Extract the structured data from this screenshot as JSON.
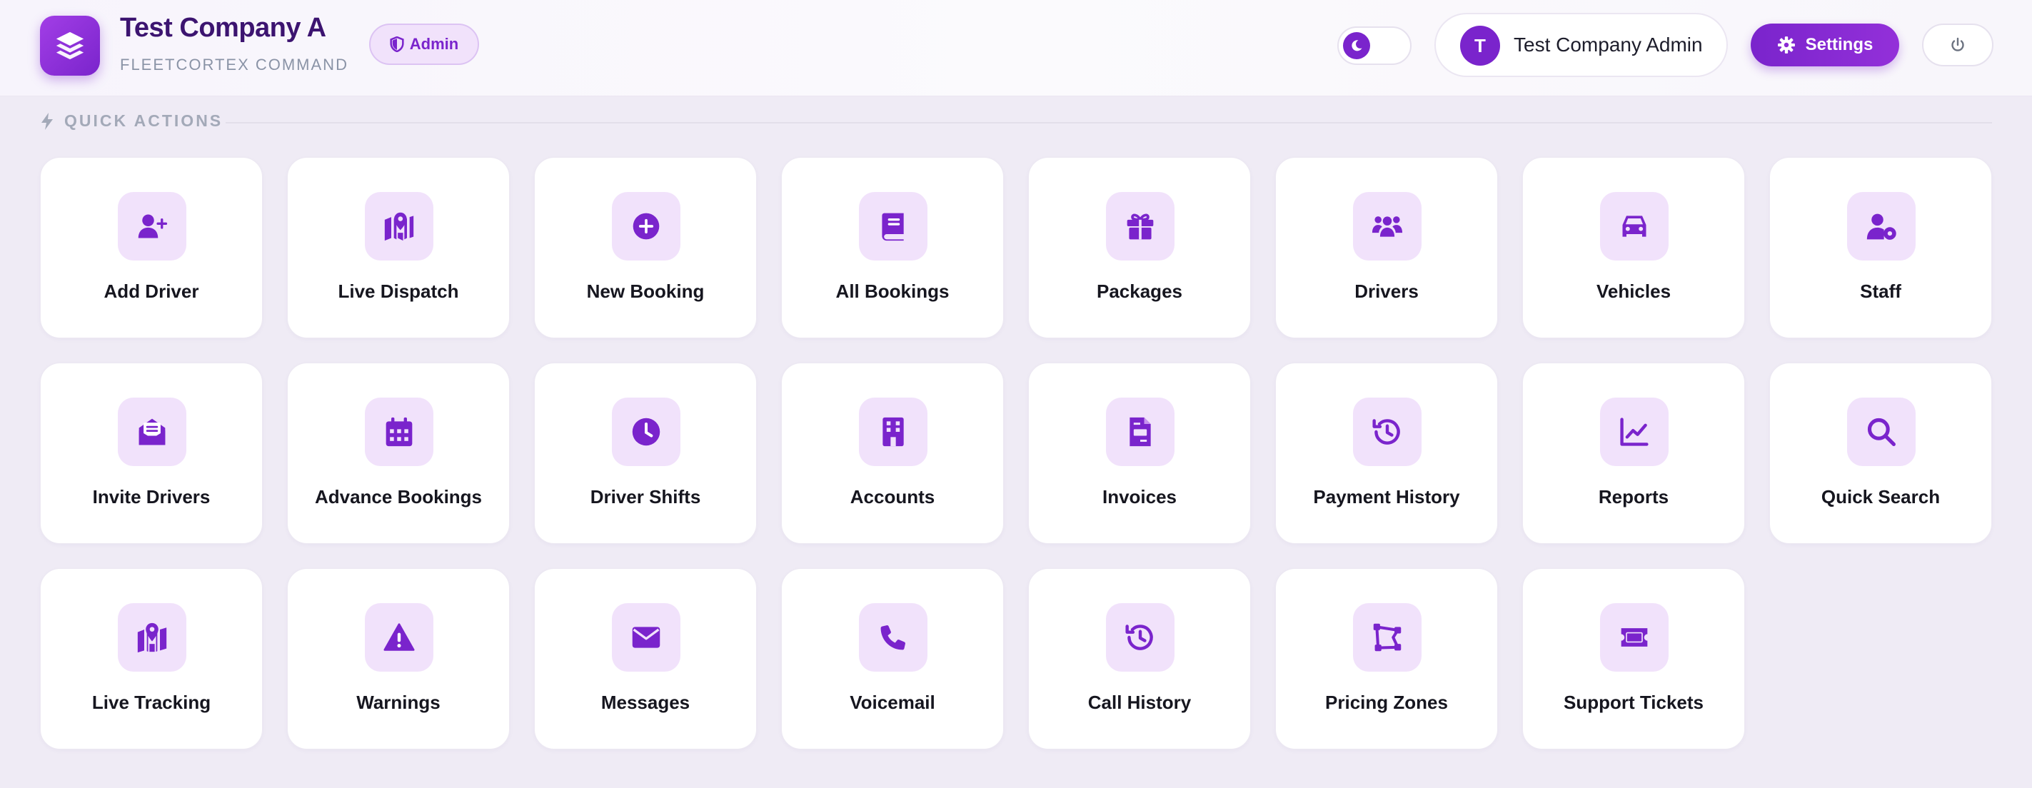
{
  "header": {
    "title": "Test Company A",
    "subtitle": "FLEETCORTEX COMMAND",
    "role_badge": "Admin",
    "user": {
      "avatar_initial": "T",
      "name": "Test Company Admin"
    },
    "settings_label": "Settings"
  },
  "theme": {
    "accent": "#7a24cc",
    "icon_bg": "#f1e2fb",
    "background": "#efebf5"
  },
  "quick_actions": {
    "title": "QUICK ACTIONS",
    "items": [
      {
        "label": "Add Driver",
        "icon": "user-plus-icon"
      },
      {
        "label": "Live Dispatch",
        "icon": "map-pin-icon"
      },
      {
        "label": "New Booking",
        "icon": "plus-circle-icon"
      },
      {
        "label": "All Bookings",
        "icon": "book-icon"
      },
      {
        "label": "Packages",
        "icon": "gift-icon"
      },
      {
        "label": "Drivers",
        "icon": "users-icon"
      },
      {
        "label": "Vehicles",
        "icon": "car-icon"
      },
      {
        "label": "Staff",
        "icon": "user-gear-icon"
      },
      {
        "label": "Invite Drivers",
        "icon": "envelope-open-icon"
      },
      {
        "label": "Advance Bookings",
        "icon": "calendar-icon"
      },
      {
        "label": "Driver Shifts",
        "icon": "clock-icon"
      },
      {
        "label": "Accounts",
        "icon": "building-icon"
      },
      {
        "label": "Invoices",
        "icon": "invoice-icon"
      },
      {
        "label": "Payment History",
        "icon": "history-icon"
      },
      {
        "label": "Reports",
        "icon": "chart-line-icon"
      },
      {
        "label": "Quick Search",
        "icon": "search-icon"
      },
      {
        "label": "Live Tracking",
        "icon": "map-location-icon"
      },
      {
        "label": "Warnings",
        "icon": "warning-icon"
      },
      {
        "label": "Messages",
        "icon": "envelope-icon"
      },
      {
        "label": "Voicemail",
        "icon": "phone-icon"
      },
      {
        "label": "Call History",
        "icon": "history-icon"
      },
      {
        "label": "Pricing Zones",
        "icon": "draw-polygon-icon"
      },
      {
        "label": "Support Tickets",
        "icon": "ticket-icon"
      }
    ]
  }
}
